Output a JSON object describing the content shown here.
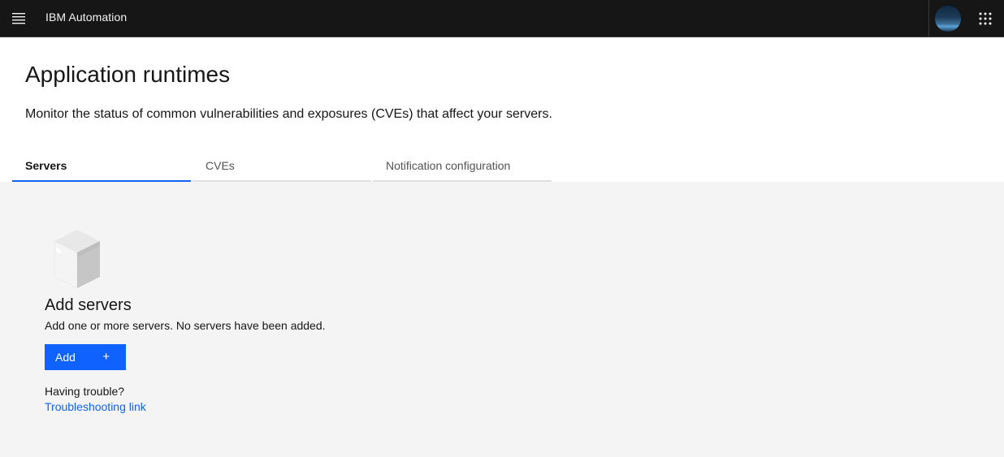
{
  "header": {
    "brand": "IBM Automation",
    "menu_icon": "hamburger-menu-icon",
    "avatar_icon": "user-avatar",
    "switcher_icon": "app-switcher-grid-icon"
  },
  "page": {
    "title": "Application runtimes",
    "description": "Monitor the status of common vulnerabilities and exposures (CVEs) that affect your servers."
  },
  "tabs": [
    {
      "label": "Servers",
      "active": true
    },
    {
      "label": "CVEs",
      "active": false
    },
    {
      "label": "Notification configuration",
      "active": false
    }
  ],
  "empty_state": {
    "illustration": "empty-box-icon",
    "title": "Add servers",
    "description": "Add one or more servers. No servers have been added.",
    "add_button_label": "Add",
    "add_button_icon": "+",
    "trouble_label": "Having trouble?",
    "trouble_link": "Troubleshooting link"
  },
  "colors": {
    "header_bg": "#161616",
    "accent": "#0f62fe",
    "content_bg": "#f4f4f4"
  }
}
